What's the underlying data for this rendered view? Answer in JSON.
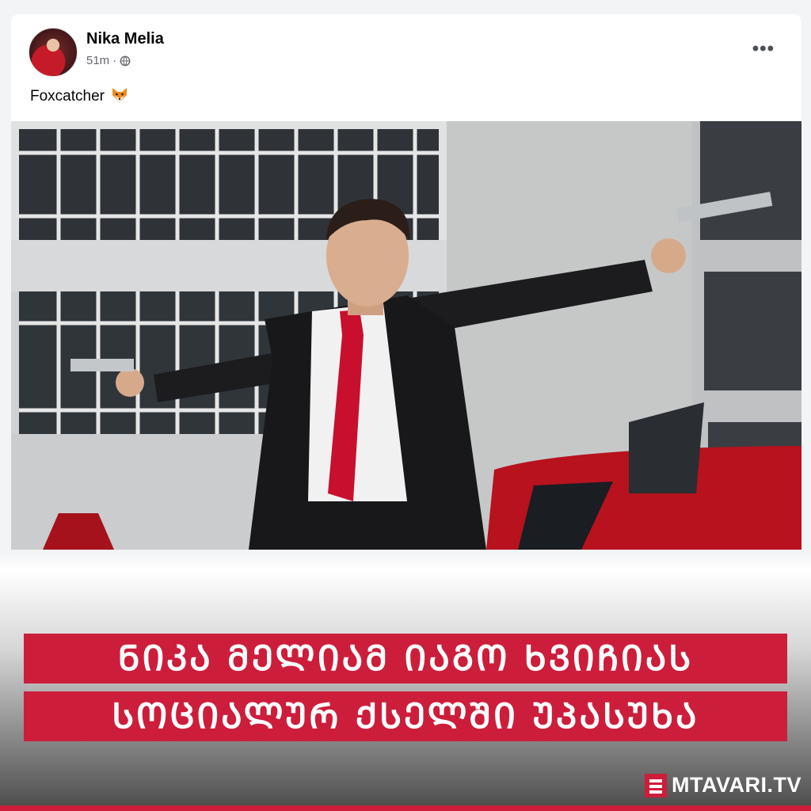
{
  "post": {
    "author": "Nika Melia",
    "time": "51m",
    "separator": "·",
    "privacy_icon": "globe-icon",
    "more_icon": "more-options-icon",
    "more_glyph": "•••",
    "text": "Foxcatcher",
    "emoji_icon": "fox-face-icon"
  },
  "headline": {
    "line1": "ᲜᲘᲙᲐ ᲛᲔᲚᲘᲐᲛ ᲘᲐᲒᲝ ᲮᲕᲘᲩᲘᲐᲡ",
    "line2": "ᲡᲝᲪᲘᲐᲚᲣᲠ ᲥᲡᲔᲚᲨᲘ ᲣᲞᲐᲡᲣᲮᲐ"
  },
  "brand": {
    "name": "MTAVARI.TV",
    "logo_icon": "mtavari-logo-icon"
  },
  "colors": {
    "accent": "#cc1e3b",
    "author_text": "#050505",
    "meta_text": "#65676b"
  }
}
